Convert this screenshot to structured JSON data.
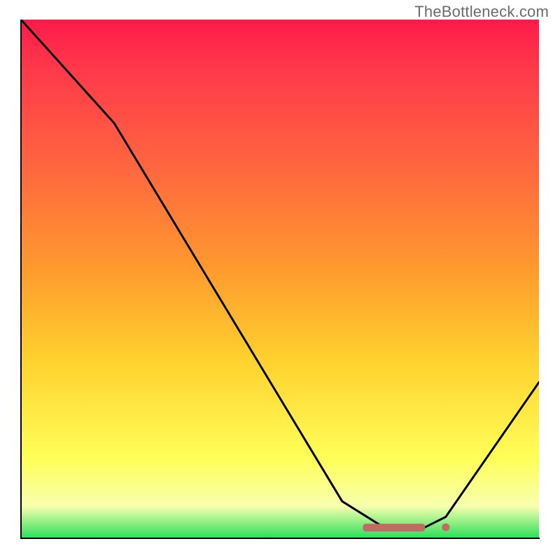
{
  "watermark": "TheBottleneck.com",
  "chart_data": {
    "type": "line",
    "title": "",
    "xlabel": "",
    "ylabel": "",
    "xlim": [
      0,
      100
    ],
    "ylim": [
      0,
      100
    ],
    "x": [
      0,
      18,
      62,
      70,
      78,
      82,
      100
    ],
    "values": [
      100,
      80,
      7,
      2,
      2,
      4,
      30
    ],
    "annotations": [
      {
        "kind": "marker_band",
        "x_start": 66,
        "x_end": 78,
        "y": 2
      },
      {
        "kind": "marker_dot",
        "x": 82,
        "y": 2
      }
    ],
    "gradient_stops": [
      {
        "pos": 0,
        "color": "#ff1a4a"
      },
      {
        "pos": 10,
        "color": "#ff3a4a"
      },
      {
        "pos": 30,
        "color": "#ff6a3e"
      },
      {
        "pos": 48,
        "color": "#ff9a2e"
      },
      {
        "pos": 66,
        "color": "#ffd22e"
      },
      {
        "pos": 85,
        "color": "#ffff5a"
      },
      {
        "pos": 94,
        "color": "#f6ffae"
      },
      {
        "pos": 100,
        "color": "#2ee05c"
      }
    ]
  }
}
